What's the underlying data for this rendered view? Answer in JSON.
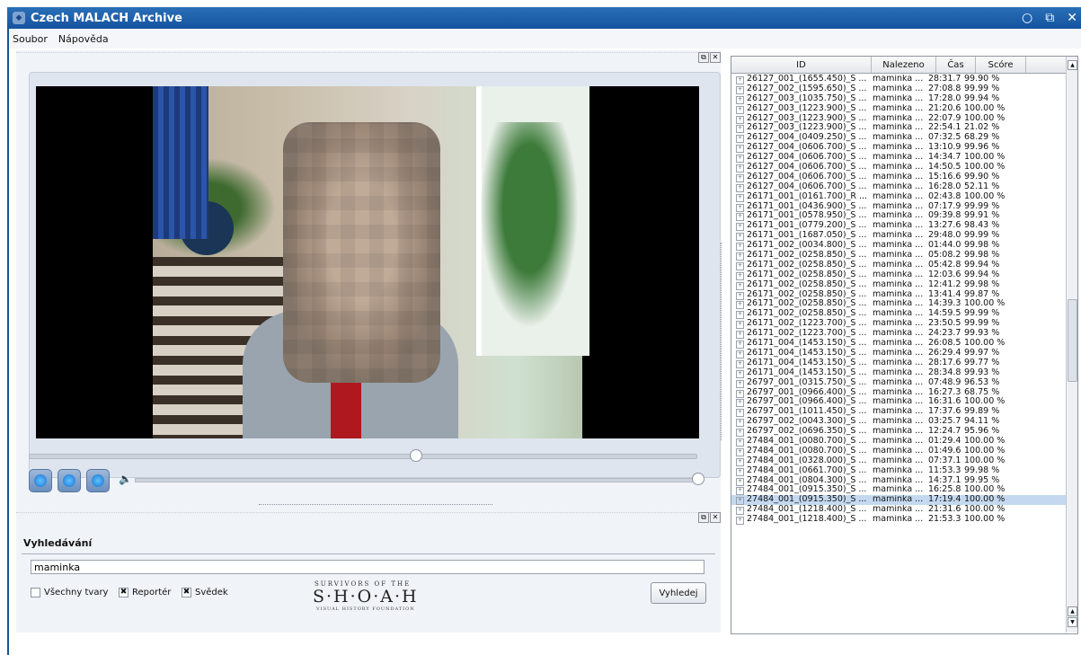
{
  "window": {
    "title": "Czech MALACH Archive",
    "ctrl_min": "○",
    "ctrl_max": "⧉",
    "ctrl_close": "✕"
  },
  "menu": {
    "items": [
      "Soubor",
      "Nápověda"
    ]
  },
  "player": {
    "volume_icon": "speaker-icon",
    "seek_fraction": 0.58,
    "volume_fraction": 1.0
  },
  "search": {
    "tab_label": "Vyhledávání",
    "query": "maminka",
    "options": [
      {
        "label": "Všechny tvary",
        "checked": false
      },
      {
        "label": "Reportér",
        "checked": true
      },
      {
        "label": "Svědek",
        "checked": true
      }
    ],
    "button_label": "Vyhledej"
  },
  "logo": {
    "top": "SURVIVORS OF THE",
    "main": "S·H·O·A·H",
    "bottom": "VISUAL HISTORY FOUNDATION"
  },
  "results": {
    "columns": [
      "ID",
      "Nalezeno",
      "Čas",
      "Scóre"
    ],
    "selected_index": 43,
    "rows": [
      [
        "26127_001_(1655.450)_S ...",
        "maminka ...",
        "28:31.7",
        "99.90 %"
      ],
      [
        "26127_002_(1595.650)_S ...",
        "maminka ...",
        "27:08.8",
        "99.99 %"
      ],
      [
        "26127_003_(1035.750)_S ...",
        "maminka ...",
        "17:28.0",
        "99.94 %"
      ],
      [
        "26127_003_(1223.900)_S ...",
        "maminka ...",
        "21:20.6",
        "100.00 %"
      ],
      [
        "26127_003_(1223.900)_S ...",
        "maminka ...",
        "22:07.9",
        "100.00 %"
      ],
      [
        "26127_003_(1223.900)_S ...",
        "maminka ...",
        "22:54.1",
        "21.02 %"
      ],
      [
        "26127_004_(0409.250)_S ...",
        "maminka ...",
        "07:32.5",
        "68.29 %"
      ],
      [
        "26127_004_(0606.700)_S ...",
        "maminka ...",
        "13:10.9",
        "99.96 %"
      ],
      [
        "26127_004_(0606.700)_S ...",
        "maminka ...",
        "14:34.7",
        "100.00 %"
      ],
      [
        "26127_004_(0606.700)_S ...",
        "maminka ...",
        "14:50.5",
        "100.00 %"
      ],
      [
        "26127_004_(0606.700)_S ...",
        "maminka ...",
        "15:16.6",
        "99.90 %"
      ],
      [
        "26127_004_(0606.700)_S ...",
        "maminka ...",
        "16:28.0",
        "52.11 %"
      ],
      [
        "26171_001_(0161.700)_R ...",
        "maminka ...",
        "02:43.8",
        "100.00 %"
      ],
      [
        "26171_001_(0436.900)_S ...",
        "maminka ...",
        "07:17.9",
        "99.99 %"
      ],
      [
        "26171_001_(0578.950)_S ...",
        "maminka ...",
        "09:39.8",
        "99.91 %"
      ],
      [
        "26171_001_(0779.200)_S ...",
        "maminka ...",
        "13:27.6",
        "98.43 %"
      ],
      [
        "26171_001_(1687.050)_S ...",
        "maminka ...",
        "29:48.0",
        "99.99 %"
      ],
      [
        "26171_002_(0034.800)_S ...",
        "maminka ...",
        "01:44.0",
        "99.98 %"
      ],
      [
        "26171_002_(0258.850)_S ...",
        "maminka ...",
        "05:08.2",
        "99.98 %"
      ],
      [
        "26171_002_(0258.850)_S ...",
        "maminka ...",
        "05:42.8",
        "99.94 %"
      ],
      [
        "26171_002_(0258.850)_S ...",
        "maminka ...",
        "12:03.6",
        "99.94 %"
      ],
      [
        "26171_002_(0258.850)_S ...",
        "maminka ...",
        "12:41.2",
        "99.98 %"
      ],
      [
        "26171_002_(0258.850)_S ...",
        "maminka ...",
        "13:41.4",
        "99.87 %"
      ],
      [
        "26171_002_(0258.850)_S ...",
        "maminka ...",
        "14:39.3",
        "100.00 %"
      ],
      [
        "26171_002_(0258.850)_S ...",
        "maminka ...",
        "14:59.5",
        "99.99 %"
      ],
      [
        "26171_002_(1223.700)_S ...",
        "maminka ...",
        "23:50.5",
        "99.99 %"
      ],
      [
        "26171_002_(1223.700)_S ...",
        "maminka ...",
        "24:23.7",
        "99.93 %"
      ],
      [
        "26171_004_(1453.150)_S ...",
        "maminka ...",
        "26:08.5",
        "100.00 %"
      ],
      [
        "26171_004_(1453.150)_S ...",
        "maminka ...",
        "26:29.4",
        "99.97 %"
      ],
      [
        "26171_004_(1453.150)_S ...",
        "maminka ...",
        "28:17.6",
        "99.77 %"
      ],
      [
        "26171_004_(1453.150)_S ...",
        "maminka ...",
        "28:34.8",
        "99.93 %"
      ],
      [
        "26797_001_(0315.750)_S ...",
        "maminka ...",
        "07:48.9",
        "96.53 %"
      ],
      [
        "26797_001_(0966.400)_S ...",
        "maminka ...",
        "16:27.3",
        "68.75 %"
      ],
      [
        "26797_001_(0966.400)_S ...",
        "maminka ...",
        "16:31.6",
        "100.00 %"
      ],
      [
        "26797_001_(1011.450)_S ...",
        "maminka ...",
        "17:37.6",
        "99.89 %"
      ],
      [
        "26797_002_(0043.300)_S ...",
        "maminka ...",
        "03:25.7",
        "94.11 %"
      ],
      [
        "26797_002_(0696.350)_S ...",
        "maminka ...",
        "12:24.7",
        "95.96 %"
      ],
      [
        "27484_001_(0080.700)_S ...",
        "maminka ...",
        "01:29.4",
        "100.00 %"
      ],
      [
        "27484_001_(0080.700)_S ...",
        "maminka ...",
        "01:49.6",
        "100.00 %"
      ],
      [
        "27484_001_(0328.000)_S ...",
        "maminka ...",
        "07:37.1",
        "100.00 %"
      ],
      [
        "27484_001_(0661.700)_S ...",
        "maminka ...",
        "11:53.3",
        "99.98 %"
      ],
      [
        "27484_001_(0804.300)_S ...",
        "maminka ...",
        "14:37.1",
        "99.95 %"
      ],
      [
        "27484_001_(0915.350)_S ...",
        "maminka ...",
        "16:25.8",
        "100.00 %"
      ],
      [
        "27484_001_(0915.350)_S ...",
        "maminka ...",
        "17:19.4",
        "100.00 %"
      ],
      [
        "27484_001_(1218.400)_S ...",
        "maminka ...",
        "21:31.6",
        "100.00 %"
      ],
      [
        "27484_001_(1218.400)_S ...",
        "maminka ...",
        "21:53.3",
        "100.00 %"
      ]
    ]
  }
}
